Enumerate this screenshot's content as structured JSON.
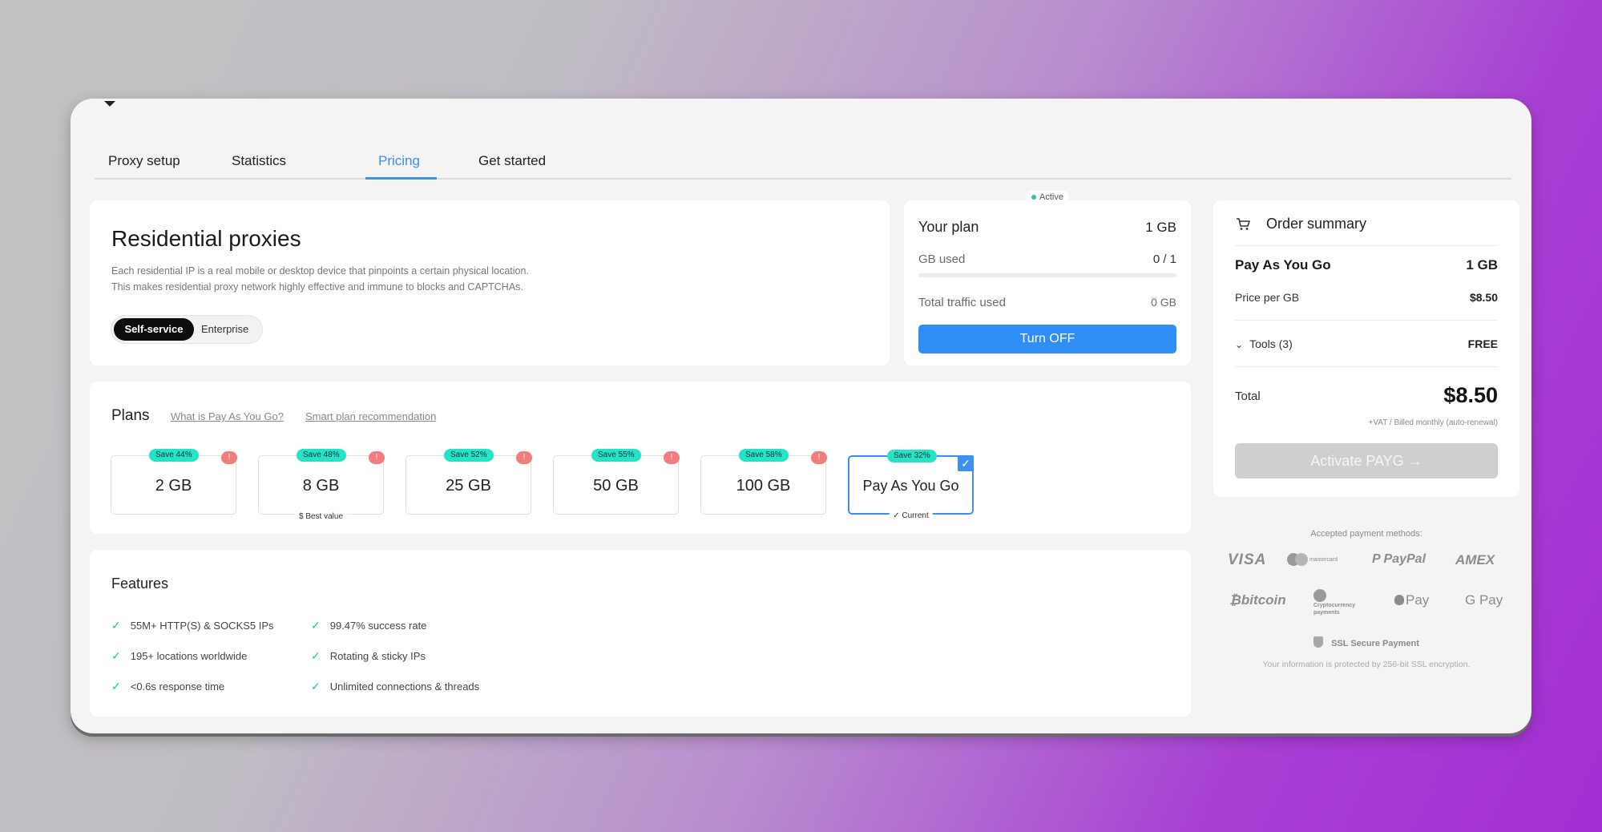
{
  "tabs": [
    "Proxy setup",
    "Statistics",
    "Pricing",
    "Get started"
  ],
  "residential": {
    "title": "Residential proxies",
    "desc1": "Each residential IP is a real mobile or desktop device that pinpoints a certain physical location.",
    "desc2": "This makes residential proxy network highly effective and immune to blocks and CAPTCHAs.",
    "seg_on": "Self-service",
    "seg_off": "Enterprise"
  },
  "your_plan": {
    "badge": "Active",
    "title": "Your plan",
    "size": "1 GB",
    "gb_used_label": "GB used",
    "gb_used_value": "0 / 1",
    "gb_used_fraction": 0,
    "traffic_label": "Total traffic used",
    "traffic_value": "0 GB",
    "button": "Turn OFF"
  },
  "plans": {
    "title": "Plans",
    "link1": "What is Pay As You Go?",
    "link2": "Smart plan recommendation",
    "items": [
      {
        "size": "2 GB",
        "save": "Save 44%",
        "info": "!"
      },
      {
        "size": "8 GB",
        "save": "Save 48%",
        "info": "!",
        "note": "$ Best value"
      },
      {
        "size": "25 GB",
        "save": "Save 52%",
        "info": "!"
      },
      {
        "size": "50 GB",
        "save": "Save 55%",
        "info": "!"
      },
      {
        "size": "100 GB",
        "save": "Save 58%",
        "info": "!"
      },
      {
        "size": "Pay As You Go",
        "save": "Save 32%",
        "check": "✓",
        "note": "✓ Current"
      }
    ]
  },
  "features": {
    "title": "Features",
    "items": [
      "55M+ HTTP(S) & SOCKS5 IPs",
      "195+ locations worldwide",
      "<0.6s response time",
      "99.47% success rate",
      "Rotating & sticky IPs",
      "Unlimited connections & threads"
    ]
  },
  "order": {
    "title": "Order summary",
    "plan_label": "Pay As You Go",
    "plan_value": "1 GB",
    "price_label": "Price per GB",
    "price_value": "$8.50",
    "tools_label": "Tools (3)",
    "tools_value": "FREE",
    "total_label": "Total",
    "total_value": "$8.50",
    "vat_note": "+VAT / Billed monthly (auto-renewal)",
    "button": "Activate PAYG"
  },
  "payment": {
    "caption": "Accepted payment methods:",
    "logos": [
      "VISA",
      "mastercard",
      "PayPal",
      "AMEX",
      "bitcoin",
      "Cryptocurrency payments",
      "Pay",
      "G Pay"
    ],
    "ssl_title": "SSL Secure Payment",
    "ssl_note": "Your information is protected by 256-bit SSL encryption."
  }
}
